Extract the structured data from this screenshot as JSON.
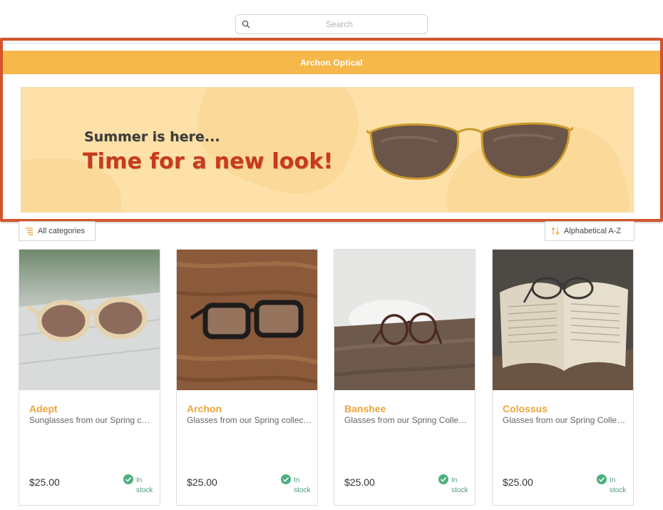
{
  "search": {
    "placeholder": "Search",
    "value": ""
  },
  "header": {
    "title": "Archon Optical"
  },
  "banner": {
    "line1": "Summer is here...",
    "line2": "Time for a new look!"
  },
  "toolbar": {
    "filter_label": "All categories",
    "sort_label": "Alphabetical A-Z"
  },
  "products": [
    {
      "name": "Adept",
      "description": "Sunglasses from our Spring collection",
      "price": "$25.00",
      "stock_line1": "In",
      "stock_line2": "stock"
    },
    {
      "name": "Archon",
      "description": "Glasses from our Spring collection",
      "price": "$25.00",
      "stock_line1": "In",
      "stock_line2": "stock"
    },
    {
      "name": "Banshee",
      "description": "Glasses from our Spring Collection",
      "price": "$25.00",
      "stock_line1": "In",
      "stock_line2": "stock"
    },
    {
      "name": "Colossus",
      "description": "Glasses from our Spring Collection",
      "price": "$25.00",
      "stock_line1": "In",
      "stock_line2": "stock"
    }
  ],
  "colors": {
    "accent": "#f6b84a",
    "title": "#eda43a",
    "highlight": "#d3542d",
    "in_stock": "#4caf7d"
  },
  "icons": {
    "search": "search-icon",
    "filter": "filter-list-icon",
    "sort": "sort-arrows-icon",
    "stock": "check-circle-icon"
  }
}
